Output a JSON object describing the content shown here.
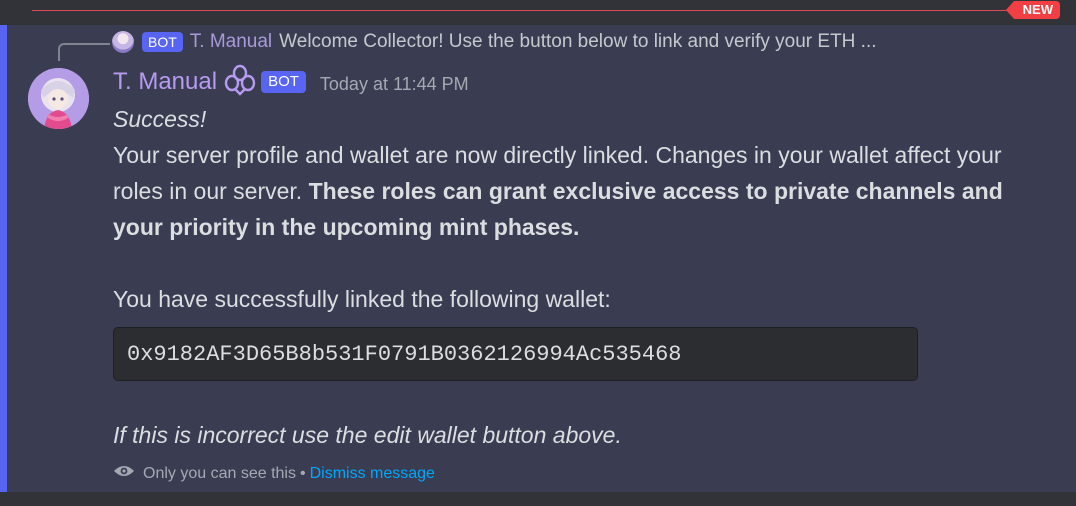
{
  "new_marker": "NEW",
  "reply": {
    "bot_tag": "BOT",
    "author": "T. Manual",
    "text": "Welcome Collector! Use the button below to link and verify your ETH ..."
  },
  "message": {
    "author": "T. Manual",
    "bot_tag": "BOT",
    "timestamp": "Today at 11:44 PM",
    "success": "Success!",
    "para1_normal": "Your server profile and wallet are now directly linked. Changes in your wallet affect your roles in our server. ",
    "para1_bold": "These roles can grant exclusive access to private channels and your priority in the upcoming mint phases.",
    "linked_text": "You have successfully linked the following wallet:",
    "wallet_address": "0x9182AF3D65B8b531F0791B0362126994Ac535468",
    "incorrect_text": "If this is incorrect use the edit wallet button above."
  },
  "footer": {
    "only_you": "Only you can see this",
    "separator": "•",
    "dismiss": "Dismiss message"
  },
  "colors": {
    "background": "#313338",
    "message_highlight": "#3a3c52",
    "accent_bar": "#5865f2",
    "author": "#b79bf1",
    "link": "#00a8fc",
    "new_badge": "#f23f43"
  },
  "icons": [
    "eye-icon",
    "badge-emoji-icon",
    "bot-avatar"
  ]
}
